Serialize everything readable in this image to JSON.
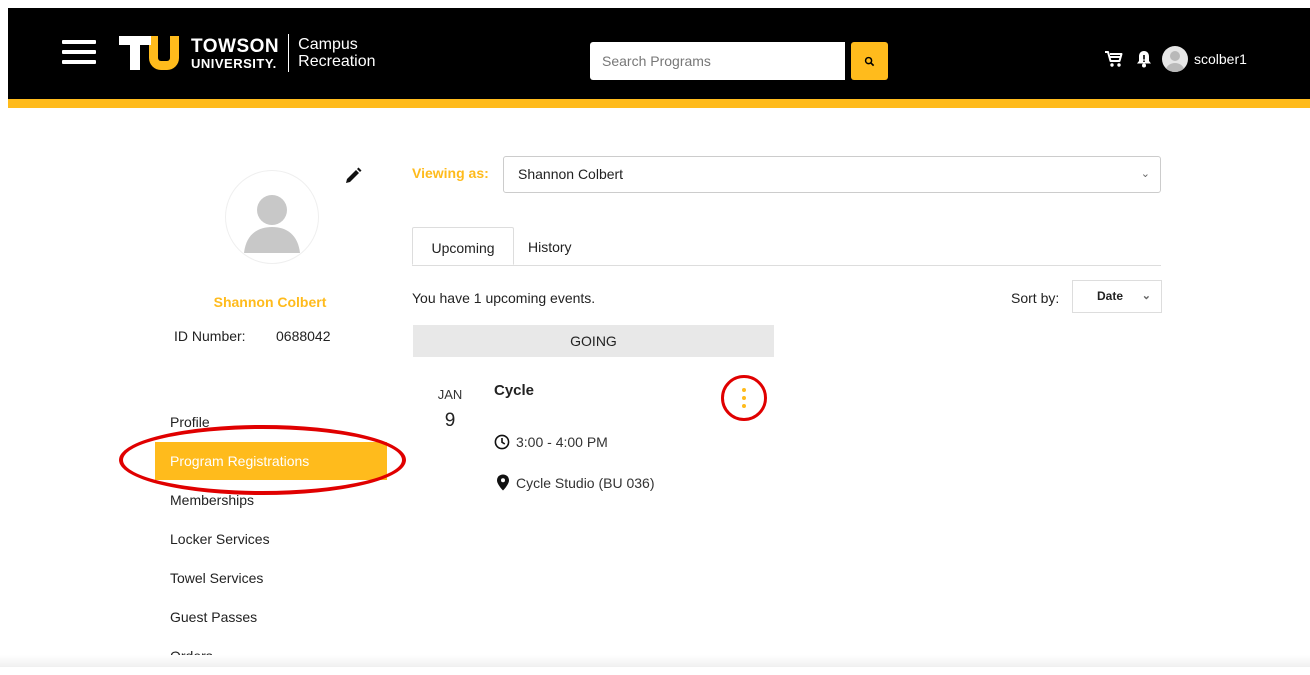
{
  "header": {
    "logo_line1": "TOWSON",
    "logo_line2": "UNIVERSITY.",
    "logo_campus1": "Campus",
    "logo_campus2": "Recreation",
    "search_placeholder": "Search Programs",
    "username": "scolber1"
  },
  "profile": {
    "name": "Shannon Colbert",
    "id_label": "ID Number:",
    "id_value": "0688042"
  },
  "sidebar": {
    "items": [
      {
        "label": "Profile",
        "active": false
      },
      {
        "label": "Program Registrations",
        "active": true
      },
      {
        "label": "Memberships",
        "active": false
      },
      {
        "label": "Locker Services",
        "active": false
      },
      {
        "label": "Towel Services",
        "active": false
      },
      {
        "label": "Guest Passes",
        "active": false
      },
      {
        "label": "Orders",
        "active": false
      }
    ]
  },
  "main": {
    "viewing_as_label": "Viewing as:",
    "viewing_as_value": "Shannon Colbert",
    "tabs": [
      {
        "label": "Upcoming",
        "active": true
      },
      {
        "label": "History",
        "active": false
      }
    ],
    "upcoming_text": "You have 1 upcoming events.",
    "sort_label": "Sort by:",
    "sort_value": "Date",
    "section_label": "GOING",
    "event": {
      "month": "JAN",
      "day": "9",
      "title": "Cycle",
      "time": "3:00 - 4:00 PM",
      "location": "Cycle Studio (BU 036)"
    }
  },
  "colors": {
    "accent": "#ffbb1c",
    "topbar": "#000000",
    "annotation": "#e00000"
  }
}
